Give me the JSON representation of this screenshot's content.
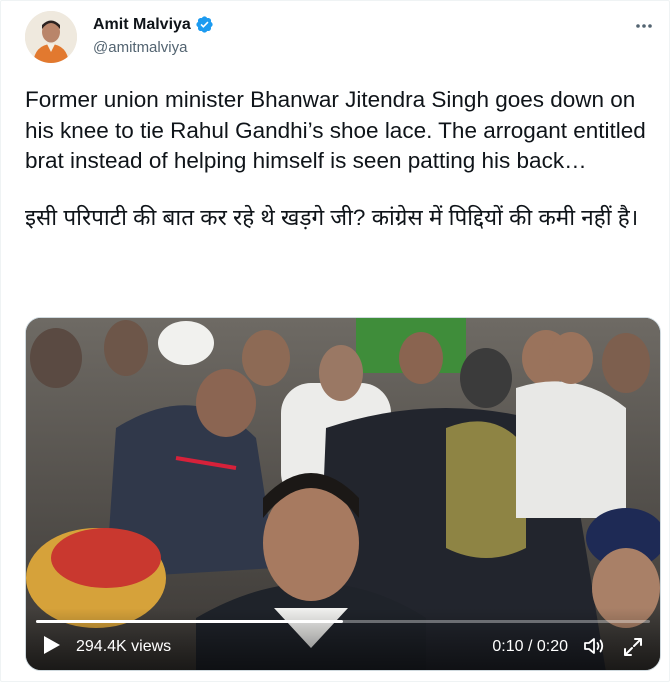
{
  "author": {
    "name": "Amit Malviya",
    "handle": "@amitmalviya",
    "verified": true
  },
  "more_icon": "more-horizontal-icon",
  "tweet": {
    "paragraph_1": "Former union minister Bhanwar Jitendra Singh goes down on his knee to tie Rahul Gandhi’s shoe lace. The arrogant entitled brat instead of helping himself is seen patting his back…",
    "paragraph_2": "इसी परिपाटी की बात कर रहे थे खड़गे जी? कांग्रेस में पिद्दियों की कमी नहीं है।"
  },
  "video": {
    "views": "294.4K views",
    "current_time": "0:10",
    "separator": "/",
    "duration": "0:20",
    "progress": 0.5,
    "icons": [
      "play-icon",
      "volume-icon",
      "fullscreen-icon"
    ]
  },
  "colors": {
    "text": "#0f1419",
    "secondary": "#536471",
    "verified": "#1d9bf0",
    "border": "#cfd9de"
  }
}
